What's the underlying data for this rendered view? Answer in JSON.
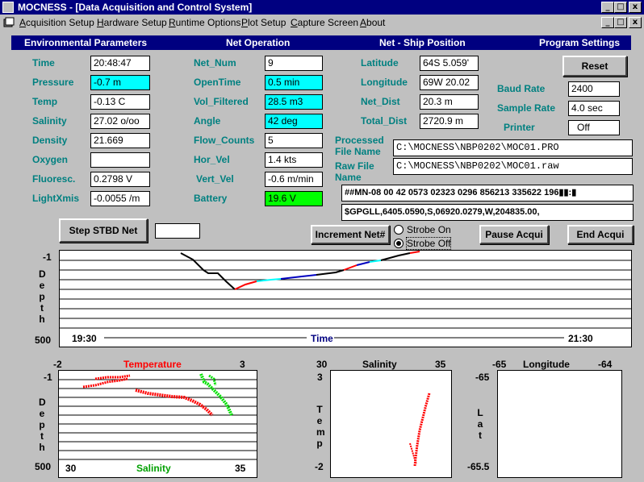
{
  "window": {
    "title": "MOCNESS - [Data Acquisition and Control System]",
    "controls": [
      "_",
      "□",
      "x"
    ],
    "mdi_controls": [
      "_",
      "□",
      "x"
    ]
  },
  "menu": [
    {
      "underline": "A",
      "rest": "cquisition Setup"
    },
    {
      "underline": "H",
      "rest": "ardware Setup"
    },
    {
      "underline": "R",
      "rest": "untime Options"
    },
    {
      "underline": "P",
      "rest": "lot Setup"
    },
    {
      "underline": "C",
      "rest": "apture Screen"
    },
    {
      "underline": "A",
      "rest": "bout"
    }
  ],
  "sections": {
    "env": "Environmental Parameters",
    "net": "Net Operation",
    "pos": "Net - Ship Position",
    "prog": "Program Settings"
  },
  "env": [
    {
      "label": "Time",
      "value": "20:48:47",
      "style": "white"
    },
    {
      "label": "Pressure",
      "value": "-0.7 m",
      "style": "cyan"
    },
    {
      "label": "Temp",
      "value": "-0.13 C",
      "style": "white"
    },
    {
      "label": "Salinity",
      "value": "27.02 o/oo",
      "style": "white"
    },
    {
      "label": "Density",
      "value": "21.669",
      "style": "white"
    },
    {
      "label": "Oxygen",
      "value": "",
      "style": "white"
    },
    {
      "label": "Fluoresc.",
      "value": "0.2798 V",
      "style": "white"
    },
    {
      "label": "LightXmis",
      "value": "-0.0055 /m",
      "style": "white"
    }
  ],
  "net": [
    {
      "label": "Net_Num",
      "value": "9",
      "style": "white"
    },
    {
      "label": "OpenTime",
      "value": "0.5 min",
      "style": "cyan"
    },
    {
      "label": "Vol_Filtered",
      "value": "28.5 m3",
      "style": "cyan"
    },
    {
      "label": "Angle",
      "value": "42 deg",
      "style": "cyan"
    },
    {
      "label": "Flow_Counts",
      "value": "5",
      "style": "white"
    },
    {
      "label": "Hor_Vel",
      "value": "1.4 kts",
      "style": "white"
    },
    {
      "label": "Vert_Vel",
      "value": "-0.6 m/min",
      "style": "white"
    },
    {
      "label": "Battery",
      "value": "19.6 V",
      "style": "green"
    }
  ],
  "pos": [
    {
      "label": "Latitude",
      "value": "64S 5.059'"
    },
    {
      "label": "Longitude",
      "value": "69W 20.02"
    },
    {
      "label": "Net_Dist",
      "value": "20.3 m"
    },
    {
      "label": "Total_Dist",
      "value": "2720.9 m"
    }
  ],
  "prog": {
    "reset_label": "Reset",
    "baud_label": "Baud Rate",
    "baud_value": "2400",
    "sample_label": "Sample Rate",
    "sample_value": "4.0 sec",
    "printer_label": "Printer",
    "printer_value": "Off"
  },
  "files": {
    "processed_label_1": "Processed",
    "processed_label_2": "File Name",
    "processed_value": "C:\\MOCNESS\\NBP0202\\MOC01.PRO",
    "raw_label_1": "Raw File",
    "raw_label_2": "Name",
    "raw_value": "C:\\MOCNESS\\NBP0202\\MOC01.raw"
  },
  "streams": {
    "mn": "##MN-08 00 42 0573 02323 0296 856213 335622 196▮▮:▮",
    "gps": "$GPGLL,6405.0590,S,06920.0279,W,204835.00,"
  },
  "buttons": {
    "step": "Step STBD Net",
    "increment": "Increment Net#",
    "pause": "Pause Acqui",
    "end": "End Acqui"
  },
  "strobe": {
    "on": "Strobe On",
    "off": "Strobe Off",
    "selected": "off"
  },
  "colors": {
    "temp": "#ff0000",
    "salinity": "#00c000",
    "title": "#000080",
    "label": "#008080"
  },
  "depth_plot": {
    "y_top": "-1",
    "y_bottom": "500",
    "y_label": "Depth",
    "x_left": "19:30",
    "x_right": "21:30",
    "x_label": "Time"
  },
  "ts_plot": {
    "top_left": "-2",
    "top_right": "3",
    "top_title": "Temperature",
    "y_top": "-1",
    "y_bottom": "500",
    "y_label": "Depth",
    "bottom_left": "30",
    "bottom_right": "35",
    "bottom_title": "Salinity"
  },
  "st_plot": {
    "top_left": "30",
    "top_right": "35",
    "top_title": "Salinity",
    "y_top": "3",
    "y_bottom": "-2",
    "y_label": "Temp"
  },
  "ll_plot": {
    "top_left": "-65",
    "top_right": "-64",
    "top_title": "Longitude",
    "y_top": "-65",
    "y_bottom": "-65.5",
    "y_label": "Lat"
  }
}
